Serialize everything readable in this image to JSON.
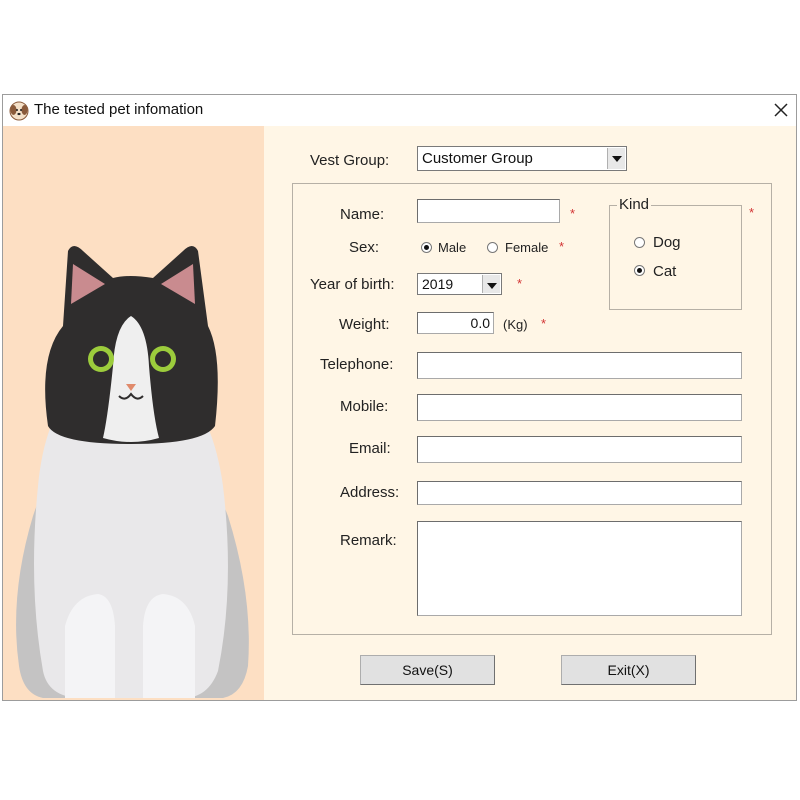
{
  "window": {
    "title": "The tested pet infomation"
  },
  "form": {
    "vest_group_label": "Vest Group:",
    "vest_group_value": "Customer Group",
    "name_label": "Name:",
    "name_value": "",
    "sex_label": "Sex:",
    "sex_options": [
      "Male",
      "Female"
    ],
    "sex_selected": "Male",
    "year_label": "Year of birth:",
    "year_value": "2019",
    "weight_label": "Weight:",
    "weight_value": "0.0",
    "weight_unit": "(Kg)",
    "telephone_label": "Telephone:",
    "mobile_label": "Mobile:",
    "email_label": "Email:",
    "address_label": "Address:",
    "remark_label": "Remark:",
    "required_mark": "*"
  },
  "kind": {
    "label": "Kind",
    "options": [
      "Dog",
      "Cat"
    ],
    "selected": "Cat"
  },
  "buttons": {
    "save": "Save(S)",
    "exit": "Exit(X)"
  },
  "icons": {
    "app": "dog-face-icon",
    "close": "close-icon"
  },
  "colors": {
    "left_panel": "#fddfc3",
    "form_bg": "#fff6e6",
    "required": "#d23232"
  }
}
